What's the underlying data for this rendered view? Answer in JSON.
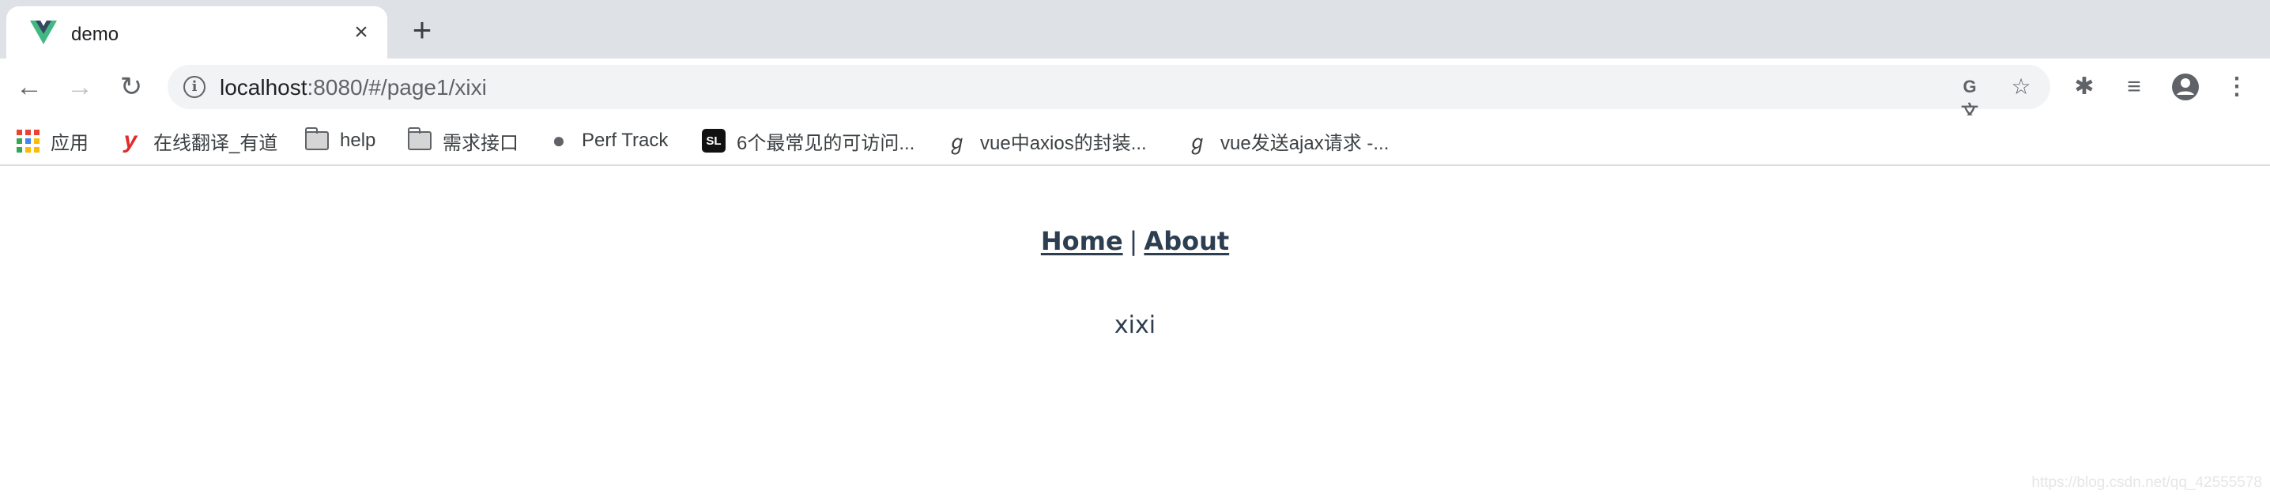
{
  "tab": {
    "title": "demo",
    "favicon": "vue-logo-icon",
    "close_label": "×",
    "new_tab_label": "+"
  },
  "toolbar": {
    "url_host": "localhost",
    "url_rest": ":8080/#/page1/xixi",
    "icons": [
      "back-icon",
      "forward-icon",
      "reload-icon",
      "info-icon",
      "translate-icon",
      "star-icon",
      "extensions-icon",
      "media-control-icon",
      "account-icon",
      "menu-icon"
    ]
  },
  "bookmarks": [
    {
      "label": "应用",
      "icon": "apps-icon"
    },
    {
      "label": "在线翻译_有道",
      "icon": "youdao-icon"
    },
    {
      "label": "help",
      "icon": "folder-icon"
    },
    {
      "label": "需求接口",
      "icon": "folder-icon"
    },
    {
      "label": "Perf Track",
      "icon": "globe-icon"
    },
    {
      "label": "6个最常见的可访问...",
      "icon": "sl-icon"
    },
    {
      "label": "vue中axios的封装...",
      "icon": "csdn-icon"
    },
    {
      "label": "vue发送ajax请求 -...",
      "icon": "csdn-icon"
    }
  ],
  "page": {
    "nav_home": "Home",
    "nav_separator": "|",
    "nav_about": "About",
    "content": "xixi",
    "watermark": "https://blog.csdn.net/qq_42555578"
  },
  "colors": {
    "text": "#2c3e50",
    "vue_green": "#41b883",
    "vue_dark": "#35495e"
  }
}
